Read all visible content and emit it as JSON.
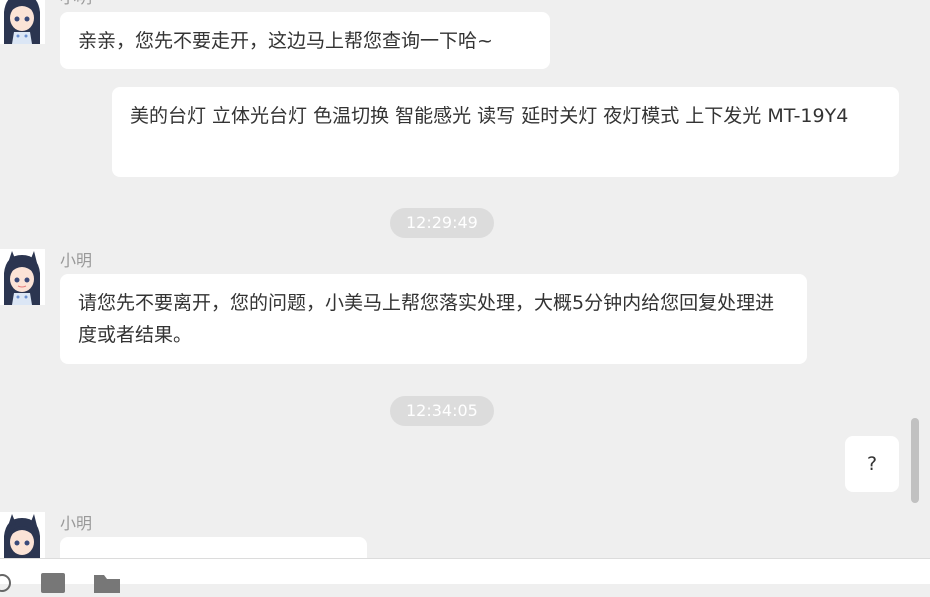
{
  "contact": {
    "name": "小明"
  },
  "messages": [
    {
      "text": "亲亲，您先不要走开，这边马上帮您查询一下哈~"
    },
    {
      "text": "美的台灯 立体光台灯 色温切换 智能感光 读写 延时关灯 夜灯模式 上下发光 MT-19Y4"
    },
    {
      "timestamp": "12:29:49"
    },
    {
      "text": "请您先不要离开，您的问题，小美马上帮您落实处理，大概5分钟内给您回复处理进度或者结果。"
    },
    {
      "timestamp": "12:34:05"
    },
    {
      "text": "?"
    }
  ],
  "icons": [
    "agent-avatar",
    "emoji-icon",
    "image-icon",
    "folder-icon"
  ],
  "colors": {
    "background": "#efefef",
    "bubble": "#ffffff",
    "timestamp_pill": "#dcdcdc"
  }
}
